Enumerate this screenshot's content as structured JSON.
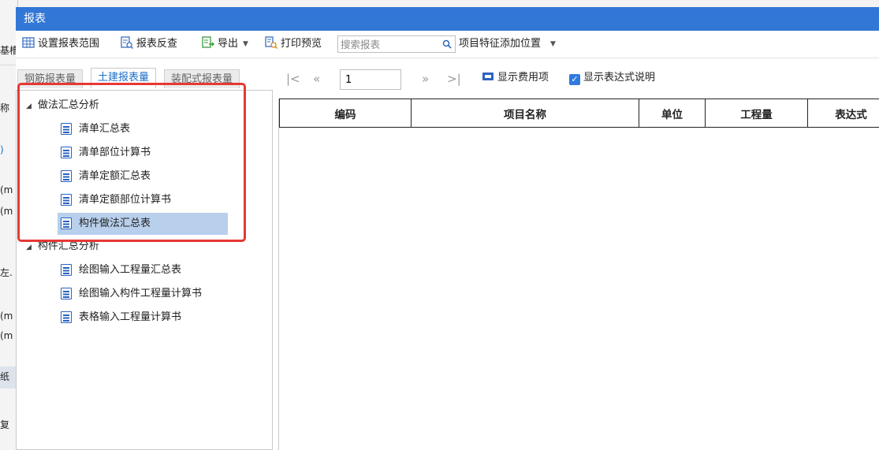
{
  "background_panel": {
    "fragments": [
      {
        "text": "基槽",
        "color": "normal"
      },
      {
        "text": "称",
        "color": "normal"
      },
      {
        "text": ")",
        "color": "blue"
      },
      {
        "text": "(m",
        "color": "normal"
      },
      {
        "text": "(m",
        "color": "normal"
      },
      {
        "text": "左.",
        "color": "normal"
      },
      {
        "text": "(m",
        "color": "normal"
      },
      {
        "text": "(m",
        "color": "normal"
      },
      {
        "text": "纸",
        "color": "normal"
      },
      {
        "text": "复",
        "color": "normal"
      }
    ]
  },
  "window": {
    "title": "报表",
    "colors": {
      "titlebar": "#3277d6",
      "accent": "#1a6fc9",
      "highlight": "#e53935",
      "selected_row": "#b8d0ec"
    }
  },
  "toolbar": {
    "set_range": "设置报表范围",
    "reverse_check": "报表反查",
    "export": "导出",
    "print_preview": "打印预览",
    "search_placeholder": "搜索报表",
    "feature_position": "项目特征添加位置"
  },
  "tabs": [
    {
      "label": "钢筋报表量",
      "active": false
    },
    {
      "label": "土建报表量",
      "active": true
    },
    {
      "label": "装配式报表量",
      "active": false
    }
  ],
  "tree": {
    "groups": [
      {
        "label": "做法汇总分析",
        "expanded": true,
        "items": [
          {
            "label": "清单汇总表",
            "selected": false
          },
          {
            "label": "清单部位计算书",
            "selected": false
          },
          {
            "label": "清单定额汇总表",
            "selected": false
          },
          {
            "label": "清单定额部位计算书",
            "selected": false
          },
          {
            "label": "构件做法汇总表",
            "selected": true
          }
        ]
      },
      {
        "label": "构件汇总分析",
        "expanded": true,
        "items": [
          {
            "label": "绘图输入工程量汇总表",
            "selected": false
          },
          {
            "label": "绘图输入构件工程量计算书",
            "selected": false
          },
          {
            "label": "表格输入工程量计算书",
            "selected": false
          }
        ]
      }
    ]
  },
  "pager": {
    "first": "|<",
    "prev": "«",
    "page_value": "1",
    "next": "»",
    "last": ">|",
    "show_fee_items": "显示费用项",
    "show_expression_desc": "显示表达式说明",
    "show_expression_desc_checked": true
  },
  "table": {
    "columns": [
      "编码",
      "项目名称",
      "单位",
      "工程量",
      "表达式"
    ]
  }
}
